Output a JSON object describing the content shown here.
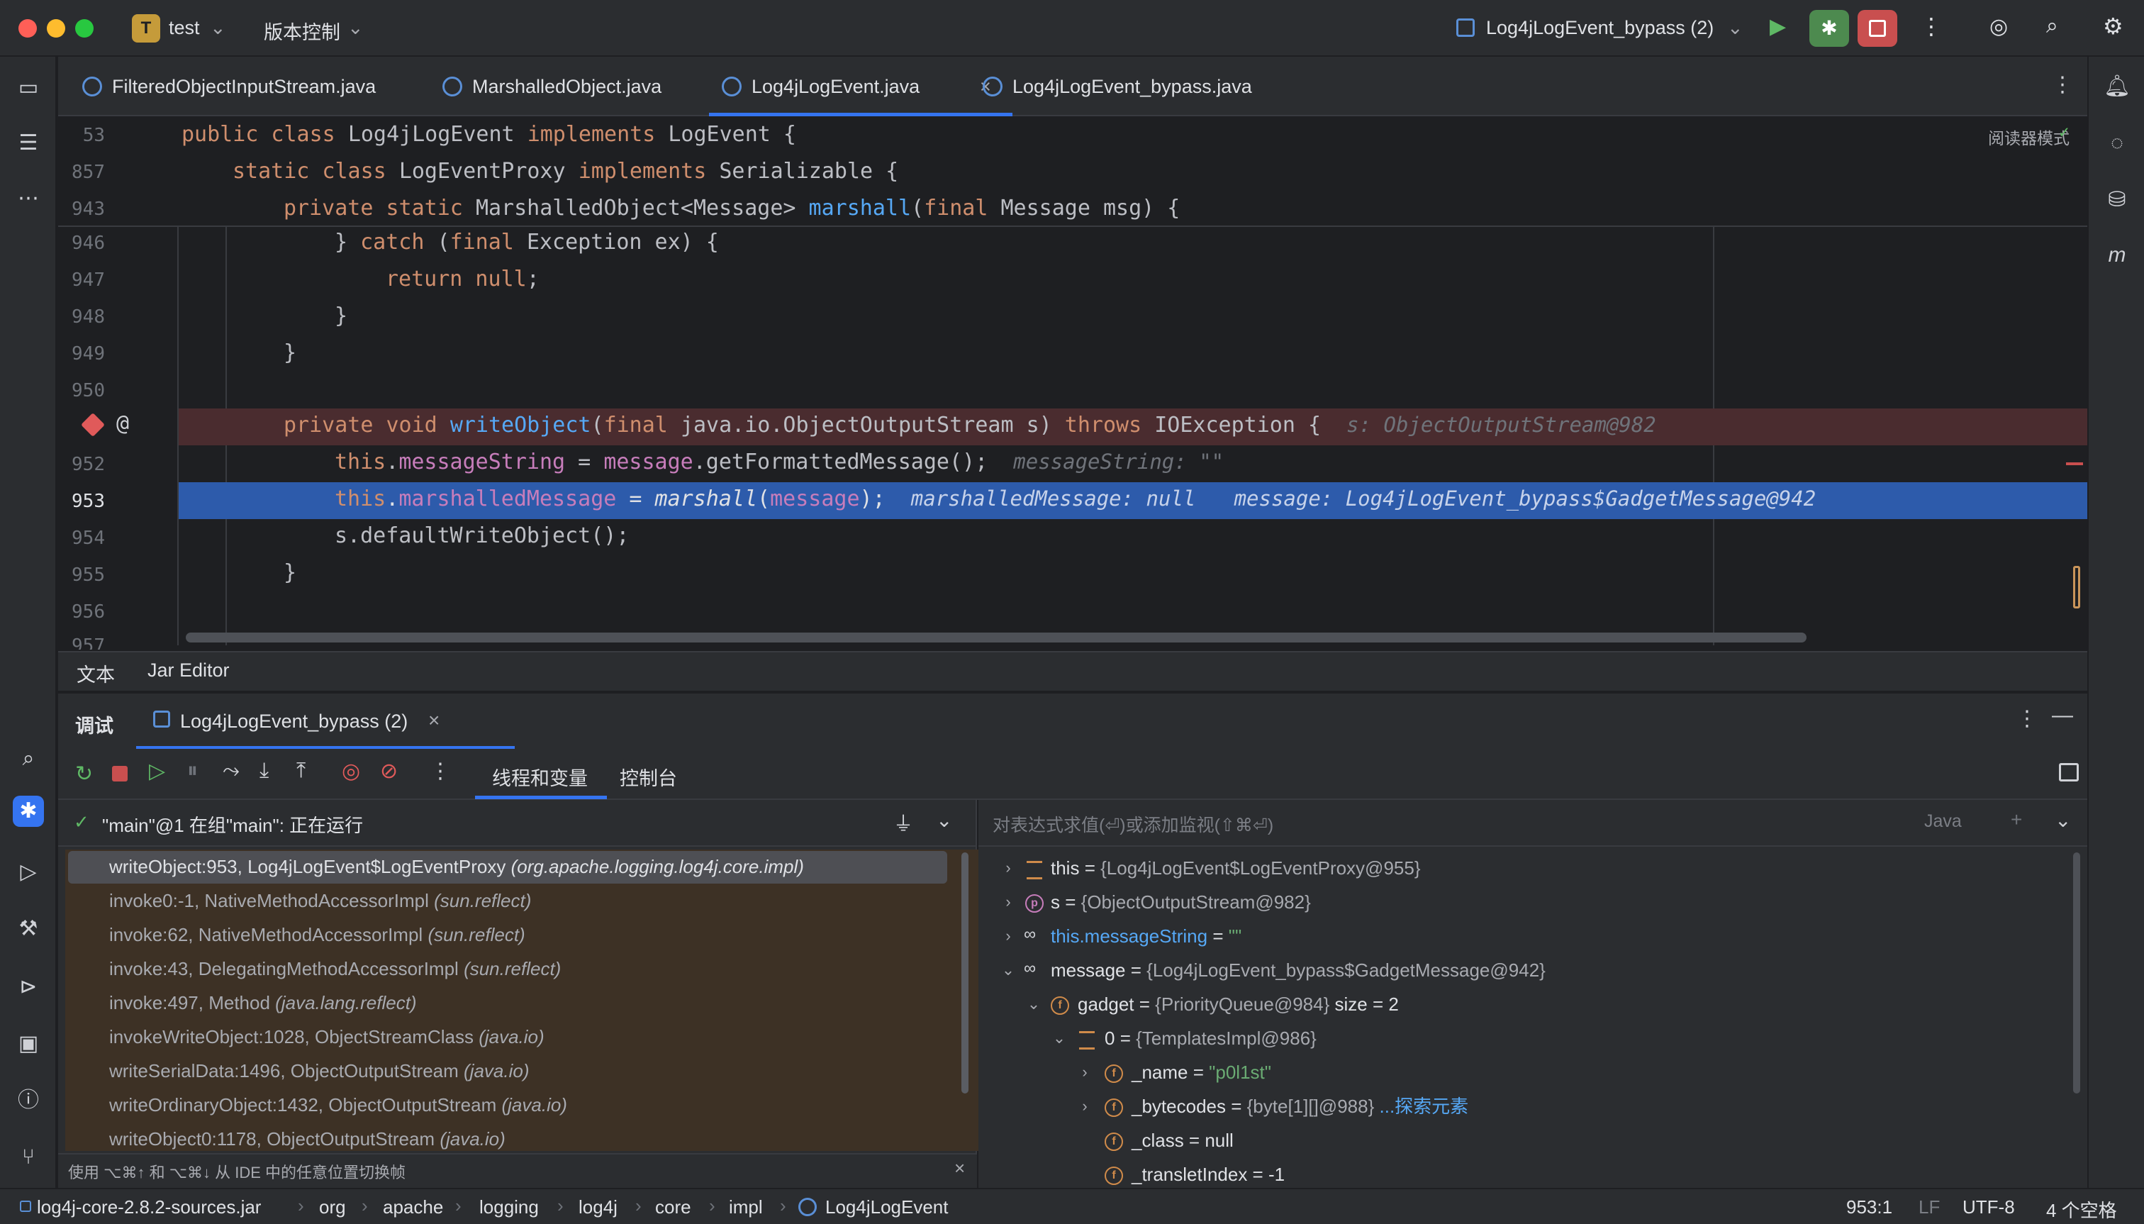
{
  "titlebar": {
    "project_badge": "T",
    "project_name": "test",
    "vcs_label": "版本控制",
    "run_config": "Log4jLogEvent_bypass (2)"
  },
  "editor_tabs": [
    {
      "label": "FilteredObjectInputStream.java",
      "active": false
    },
    {
      "label": "MarshalledObject.java",
      "active": false
    },
    {
      "label": "Log4jLogEvent.java",
      "active": true
    },
    {
      "label": "Log4jLogEvent_bypass.java",
      "active": false
    }
  ],
  "editor": {
    "reader_mode": "阅读器模式",
    "sticky_lines": [
      {
        "num": "53",
        "text": ""
      },
      {
        "num": "857",
        "text": ""
      },
      {
        "num": "943",
        "text": ""
      }
    ],
    "lines": [
      "946",
      "947",
      "948",
      "949",
      "950",
      "951",
      "952",
      "953",
      "954",
      "955",
      "956",
      "957"
    ],
    "hint_s": "s: ObjectOutputStream@982",
    "hint_messageString": "messageString: \"\"",
    "hint_marshalled": "marshalledMessage: null",
    "hint_message": "message: Log4jLogEvent_bypass$GadgetMessage@942",
    "bottom_tabs": [
      "文本",
      "Jar Editor"
    ]
  },
  "debug": {
    "tab_debug": "调试",
    "session_tab": "Log4jLogEvent_bypass (2)",
    "subtab_threads": "线程和变量",
    "subtab_console": "控制台",
    "thread_status": "\"main\"@1 在组\"main\": 正在运行",
    "eval_placeholder": "对表达式求值(⏎)或添加监视(⇧⌘⏎)",
    "lang": "Java",
    "frames_hint": "使用 ⌥⌘↑ 和 ⌥⌘↓ 从 IDE 中的任意位置切换帧",
    "frames": [
      {
        "method": "writeObject:953, Log4jLogEvent$LogEventProxy",
        "pkg": "(org.apache.logging.log4j.core.impl)"
      },
      {
        "method": "invoke0:-1, NativeMethodAccessorImpl",
        "pkg": "(sun.reflect)"
      },
      {
        "method": "invoke:62, NativeMethodAccessorImpl",
        "pkg": "(sun.reflect)"
      },
      {
        "method": "invoke:43, DelegatingMethodAccessorImpl",
        "pkg": "(sun.reflect)"
      },
      {
        "method": "invoke:497, Method",
        "pkg": "(java.lang.reflect)"
      },
      {
        "method": "invokeWriteObject:1028, ObjectStreamClass",
        "pkg": "(java.io)"
      },
      {
        "method": "writeSerialData:1496, ObjectOutputStream",
        "pkg": "(java.io)"
      },
      {
        "method": "writeOrdinaryObject:1432, ObjectOutputStream",
        "pkg": "(java.io)"
      },
      {
        "method": "writeObject0:1178, ObjectOutputStream",
        "pkg": "(java.io)"
      }
    ],
    "vars": {
      "this_name": "this",
      "this_val": "{Log4jLogEvent$LogEventProxy@955}",
      "s_name": "s",
      "s_val": "{ObjectOutputStream@982}",
      "ms_name": "this.messageString",
      "ms_val": "\"\"",
      "msg_name": "message",
      "msg_val": "{Log4jLogEvent_bypass$GadgetMessage@942}",
      "gadget_name": "gadget",
      "gadget_val": "{PriorityQueue@984}",
      "gadget_size": "size = 2",
      "zero_name": "0",
      "zero_val": "{TemplatesImpl@986}",
      "name_name": "_name",
      "name_val": "\"p0l1st\"",
      "bc_name": "_bytecodes",
      "bc_val": "{byte[1][]@988}",
      "bc_link": "...探索元素",
      "class_name": "_class",
      "class_val": "null",
      "ti_name": "_transletIndex",
      "ti_val": "-1"
    }
  },
  "statusbar": {
    "breadcrumbs": [
      "log4j-core-2.8.2-sources.jar",
      "org",
      "apache",
      "logging",
      "log4j",
      "core",
      "impl",
      "Log4jLogEvent"
    ],
    "position": "953:1",
    "line_sep": "LF",
    "encoding": "UTF-8",
    "indent": "4 个空格"
  },
  "colors": {
    "accent": "#3574f0",
    "breakpoint_line": "#4a2c2f",
    "exec_line": "#2d5bab",
    "frames_bg": "#3d3125"
  }
}
